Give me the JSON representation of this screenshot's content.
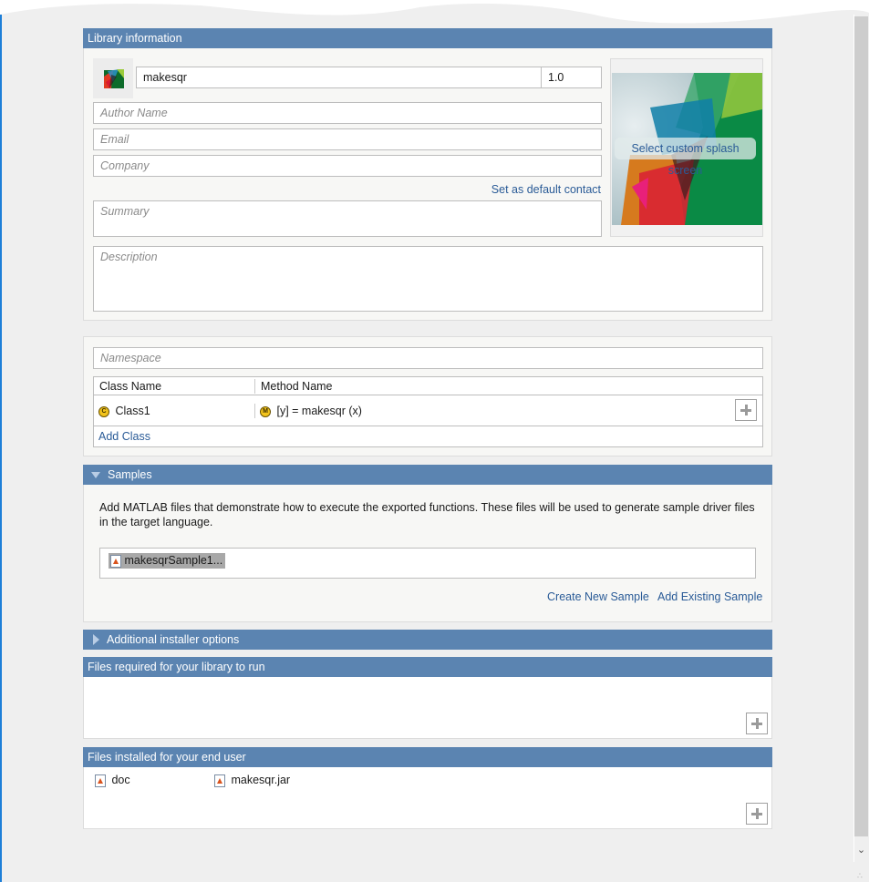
{
  "library_info": {
    "header": "Library information",
    "library_name": "makesqr",
    "version": "1.0",
    "author_placeholder": "Author Name",
    "email_placeholder": "Email",
    "company_placeholder": "Company",
    "set_default_contact": "Set as default contact",
    "summary_placeholder": "Summary",
    "description_placeholder": "Description",
    "splash_label": "Select custom splash screen"
  },
  "class_section": {
    "namespace_placeholder": "Namespace",
    "columns": [
      "Class Name",
      "Method Name"
    ],
    "rows": [
      {
        "class_badge": "C",
        "class_name": "Class1",
        "method_badge": "M",
        "method": "[y] = makesqr (x)"
      }
    ],
    "add_class": "Add Class"
  },
  "samples": {
    "header": "Samples",
    "description": "Add MATLAB files that demonstrate how to execute the exported functions.  These files will be used to generate sample driver files in the target language.",
    "files": [
      "makesqrSample1..."
    ],
    "create_new": "Create New Sample",
    "add_existing": "Add Existing Sample"
  },
  "additional_options": {
    "header": "Additional installer options"
  },
  "files_required": {
    "header": "Files required for your library to run",
    "files": []
  },
  "files_installed": {
    "header": "Files installed for your end user",
    "files": [
      "doc",
      "makesqr.jar"
    ]
  },
  "colors": {
    "header_bg": "#5b84b1",
    "link": "#2a5b97",
    "badge": "#f2c31c"
  }
}
